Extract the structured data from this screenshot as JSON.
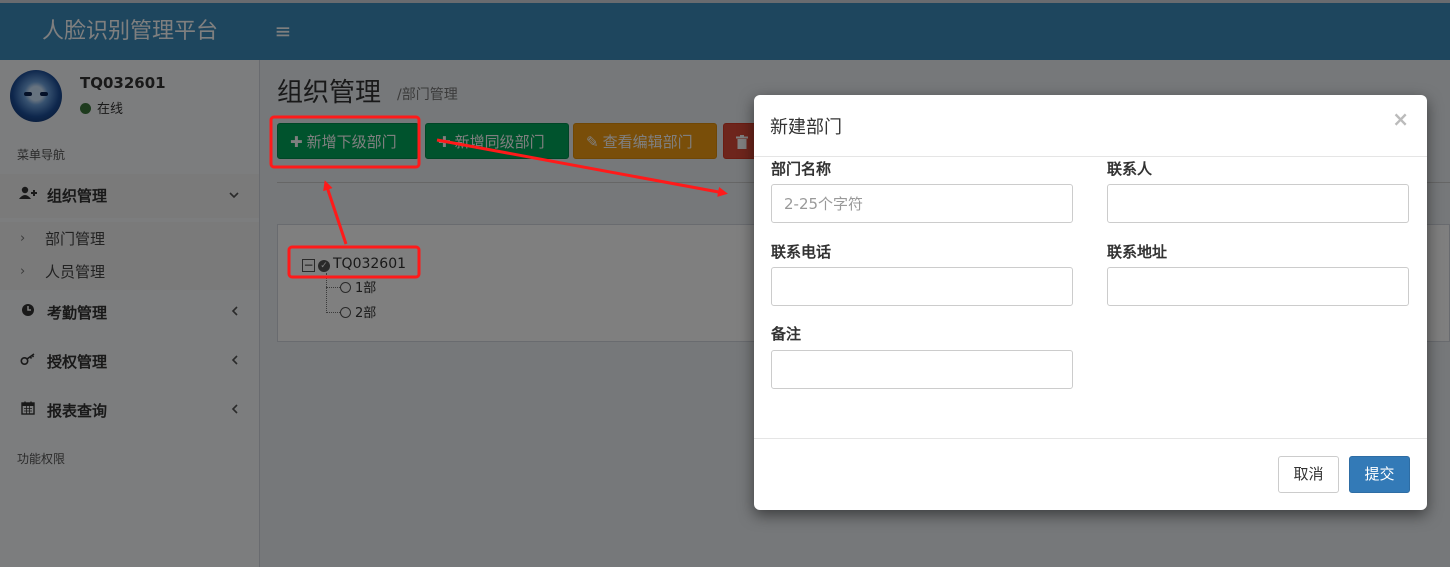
{
  "app": {
    "title": "人脸识别管理平台"
  },
  "user": {
    "name": "TQ032601",
    "status": "在线"
  },
  "sidebar": {
    "header_nav": "菜单导航",
    "header_perm": "功能权限",
    "items": [
      {
        "label": "组织管理",
        "icon": "user-plus-icon",
        "chevron": "⌄"
      },
      {
        "label": "考勤管理",
        "icon": "clock-icon",
        "chevron": "‹"
      },
      {
        "label": "授权管理",
        "icon": "key-icon",
        "chevron": "‹"
      },
      {
        "label": "报表查询",
        "icon": "calendar-icon",
        "chevron": "‹"
      }
    ],
    "subitems": [
      {
        "label": "部门管理"
      },
      {
        "label": "人员管理"
      }
    ]
  },
  "page": {
    "title": "组织管理",
    "subtitle": "/部门管理",
    "buttons": {
      "add_sub": "新增下级部门",
      "add_peer": "新增同级部门",
      "view_edit": "查看编辑部门"
    }
  },
  "tree": {
    "root": "TQ032601",
    "children": [
      "1部",
      "2部"
    ]
  },
  "modal": {
    "title": "新建部门",
    "close": "×",
    "fields": {
      "dept_name": {
        "label": "部门名称",
        "placeholder": "2-25个字符",
        "value": ""
      },
      "contact": {
        "label": "联系人",
        "value": ""
      },
      "phone": {
        "label": "联系电话",
        "value": ""
      },
      "address": {
        "label": "联系地址",
        "value": ""
      },
      "remark": {
        "label": "备注",
        "value": ""
      }
    },
    "cancel": "取消",
    "submit": "提交"
  },
  "colors": {
    "header": "#3c8dbc",
    "green": "#00a65a",
    "orange": "#f39c12",
    "red": "#dd4b39",
    "primary": "#337ab7",
    "annotation": "#ff1a1a"
  }
}
